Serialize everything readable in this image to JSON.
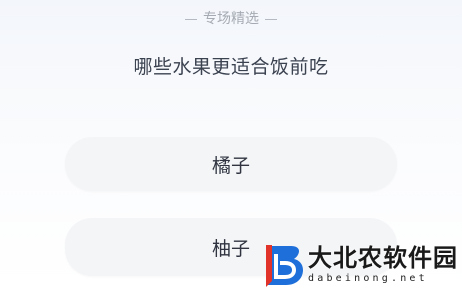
{
  "section": {
    "title": "专场精选"
  },
  "question": {
    "text": "哪些水果更适合饭前吃"
  },
  "options": [
    {
      "label": "橘子"
    },
    {
      "label": "柚子"
    }
  ],
  "watermark": {
    "title": "大北农软件园",
    "url": "dabeinong.net"
  },
  "colors": {
    "background_top": "#f3f6fb",
    "option_bg": "#f4f5f7",
    "question_text": "#3b4250",
    "tag_text": "#a6abb3",
    "logo_blue": "#1e6fd9",
    "logo_red": "#e2332b"
  }
}
